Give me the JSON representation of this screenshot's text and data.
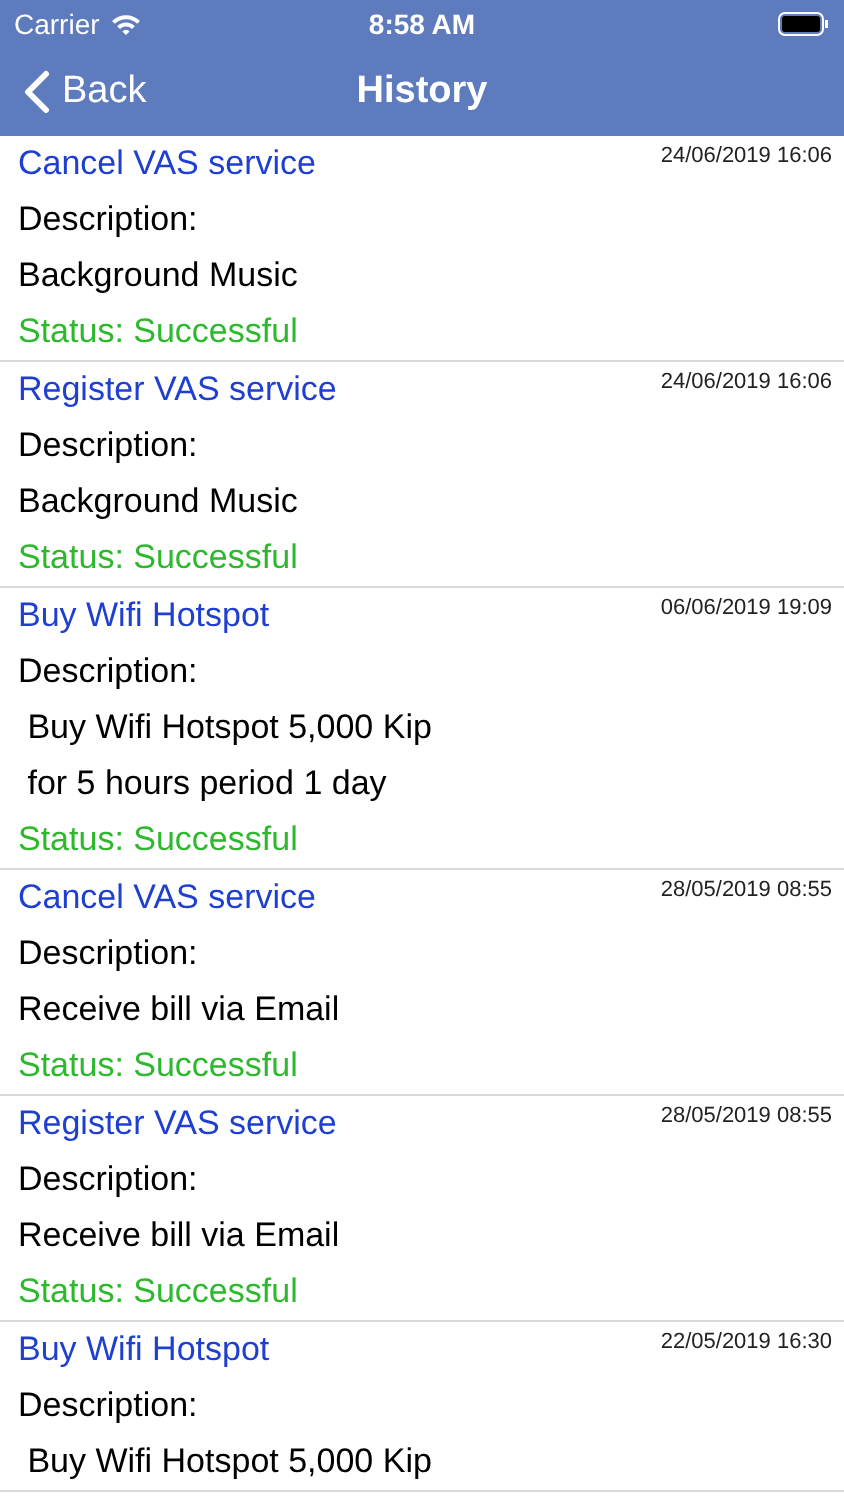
{
  "status_bar": {
    "carrier": "Carrier",
    "time": "8:58 AM"
  },
  "nav": {
    "back": "Back",
    "title": "History"
  },
  "items": [
    {
      "title": "Cancel VAS service",
      "date": "24/06/2019 16:06",
      "label": "Description:",
      "description": [
        "Background Music"
      ],
      "status": "Status: Successful"
    },
    {
      "title": "Register VAS service",
      "date": "24/06/2019 16:06",
      "label": "Description:",
      "description": [
        "Background Music"
      ],
      "status": "Status: Successful"
    },
    {
      "title": "Buy Wifi Hotspot",
      "date": "06/06/2019 19:09",
      "label": "Description:",
      "description": [
        " Buy Wifi Hotspot 5,000 Kip",
        " for 5 hours period 1 day"
      ],
      "status": "Status: Successful"
    },
    {
      "title": "Cancel VAS service",
      "date": "28/05/2019 08:55",
      "label": "Description:",
      "description": [
        "Receive bill via Email"
      ],
      "status": "Status: Successful"
    },
    {
      "title": "Register VAS service",
      "date": "28/05/2019 08:55",
      "label": "Description:",
      "description": [
        "Receive bill via Email"
      ],
      "status": "Status: Successful"
    },
    {
      "title": "Buy Wifi Hotspot",
      "date": "22/05/2019 16:30",
      "label": "Description:",
      "description": [
        " Buy Wifi Hotspot 5,000 Kip"
      ]
    }
  ]
}
